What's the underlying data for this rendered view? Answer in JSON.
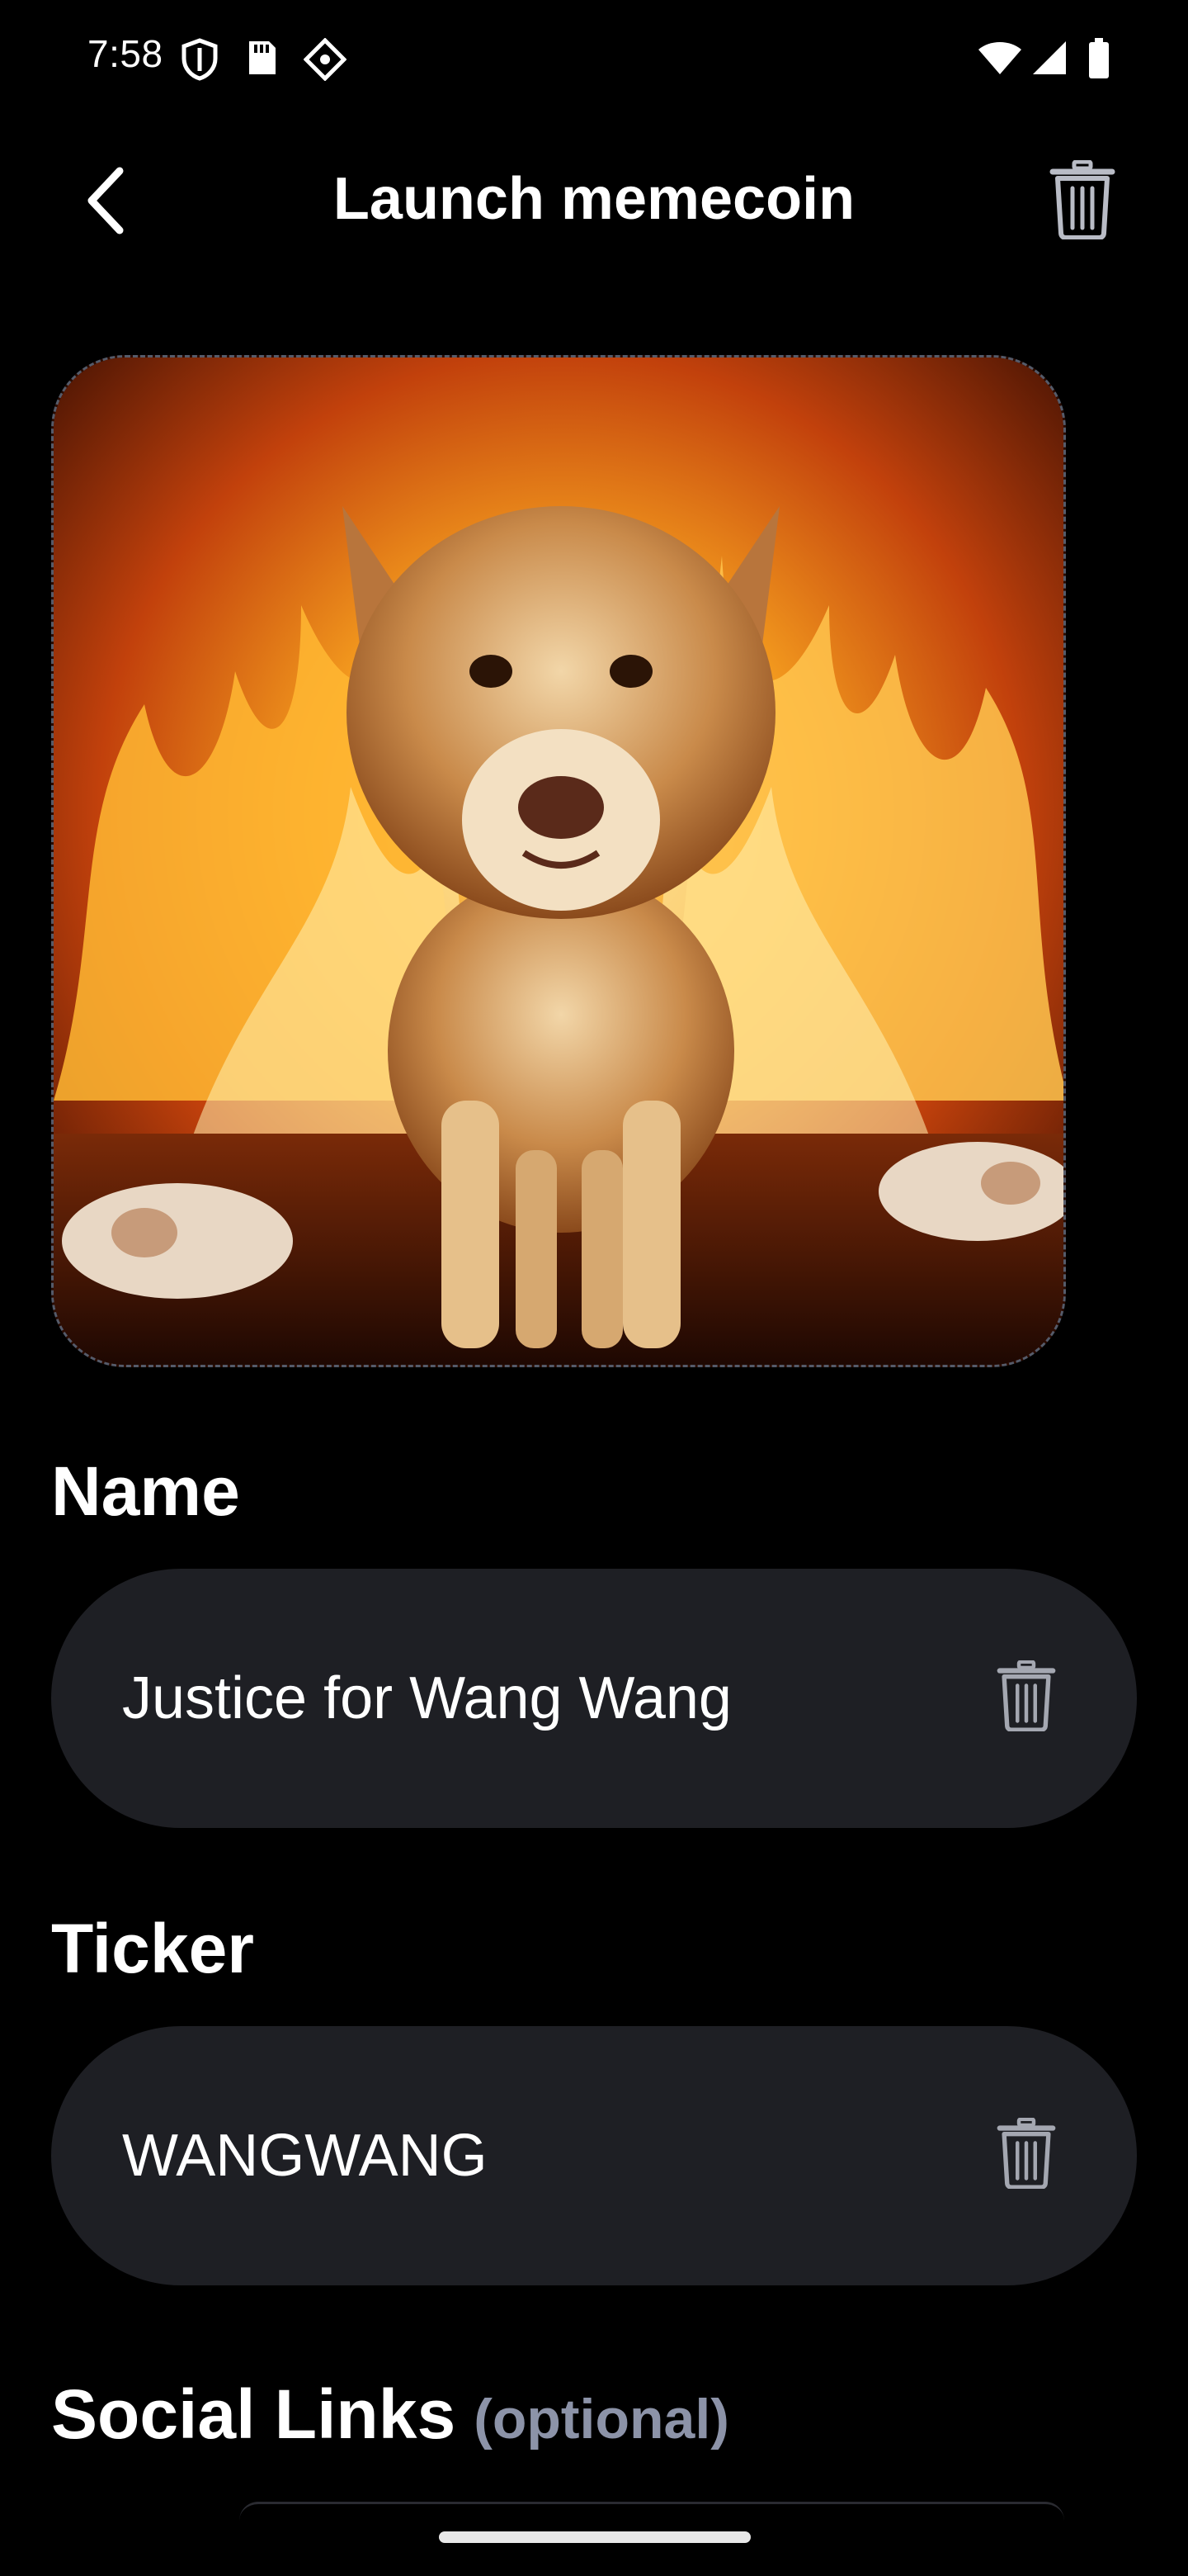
{
  "status_bar": {
    "time": "7:58",
    "left_icons": [
      "shield-icon",
      "sd-card-icon",
      "diamond-app-icon"
    ],
    "right_icons": [
      "wifi-icon",
      "cell-signal-icon",
      "battery-icon"
    ]
  },
  "header": {
    "title": "Launch memecoin",
    "back_icon": "chevron-left-icon",
    "delete_icon": "trash-icon"
  },
  "image": {
    "alt": "dog standing in fire"
  },
  "name_section": {
    "label": "Name",
    "value": "Justice for Wang Wang",
    "clear_icon": "trash-icon"
  },
  "ticker_section": {
    "label": "Ticker",
    "value": "WANGWANG",
    "clear_icon": "trash-icon"
  },
  "social_section": {
    "label": "Social Links",
    "optional": "(optional)"
  },
  "colors": {
    "background": "#000000",
    "field_background": "#1e1f24",
    "muted_text": "#8c93a8",
    "icon_gray": "#a4a7b1"
  }
}
